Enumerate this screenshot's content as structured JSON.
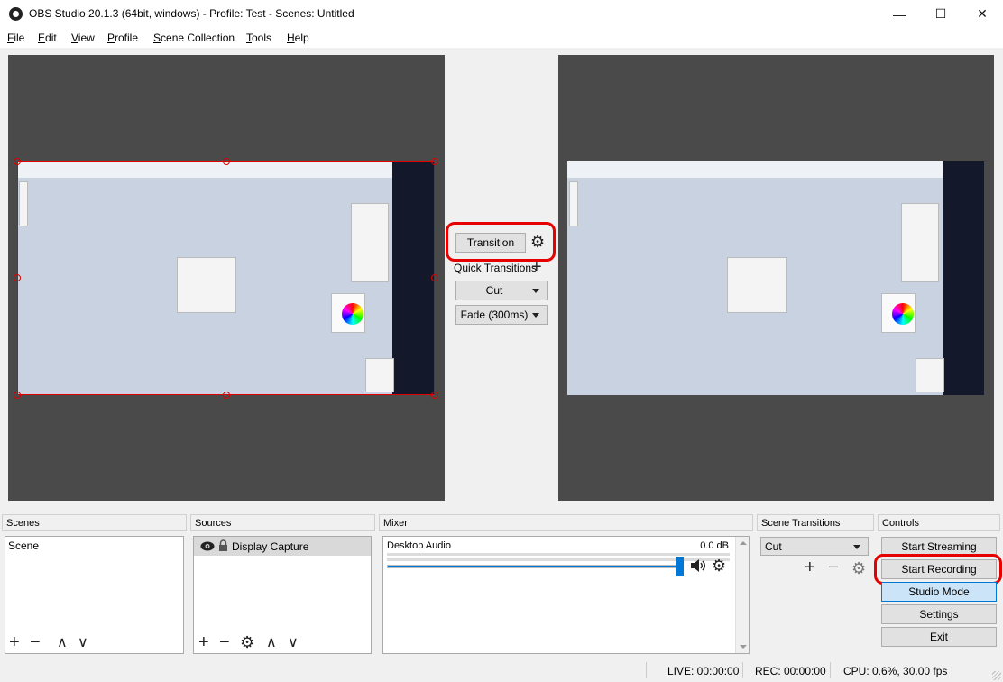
{
  "window": {
    "title": "OBS Studio 20.1.3 (64bit, windows) - Profile: Test - Scenes: Untitled",
    "minimize_glyph": "—",
    "maximize_glyph": "☐",
    "close_glyph": "✕"
  },
  "menu": {
    "file": {
      "accel": "F",
      "rest": "ile"
    },
    "edit": {
      "accel": "E",
      "rest": "dit"
    },
    "view": {
      "accel": "V",
      "rest": "iew"
    },
    "profile": {
      "accel": "P",
      "rest": "rofile"
    },
    "scene_collection": {
      "accel": "S",
      "rest": "cene Collection"
    },
    "tools": {
      "accel": "T",
      "rest": "ools"
    },
    "help": {
      "accel": "H",
      "rest": "elp"
    }
  },
  "studio": {
    "transition_button": "Transition",
    "quick_transitions_label": "Quick Transitions",
    "quick_cut": "Cut",
    "quick_fade": "Fade (300ms)"
  },
  "docks": {
    "scenes": {
      "header": "Scenes",
      "items": [
        "Scene"
      ]
    },
    "sources": {
      "header": "Sources",
      "items": [
        "Display Capture"
      ]
    },
    "mixer": {
      "header": "Mixer",
      "channel_name": "Desktop Audio",
      "channel_level": "0.0 dB",
      "volume_fraction": 1.0
    },
    "scene_transitions": {
      "header": "Scene Transitions",
      "selected": "Cut"
    },
    "controls": {
      "header": "Controls",
      "start_streaming": "Start Streaming",
      "start_recording": "Start Recording",
      "studio_mode": "Studio Mode",
      "settings": "Settings",
      "exit": "Exit"
    }
  },
  "status": {
    "live": "LIVE: 00:00:00",
    "rec": "REC: 00:00:00",
    "cpu": "CPU: 0.6%, 30.00 fps"
  },
  "icons": {
    "gear": "⚙",
    "plus": "+",
    "minus": "−",
    "up": "∧",
    "down": "∨",
    "eye": "👁",
    "lock": "🔒",
    "speaker": "🔊"
  },
  "colors": {
    "highlight_red": "#e60000",
    "studio_mode_active": "#cce4f7",
    "preview_bg": "#4a4a4a"
  }
}
